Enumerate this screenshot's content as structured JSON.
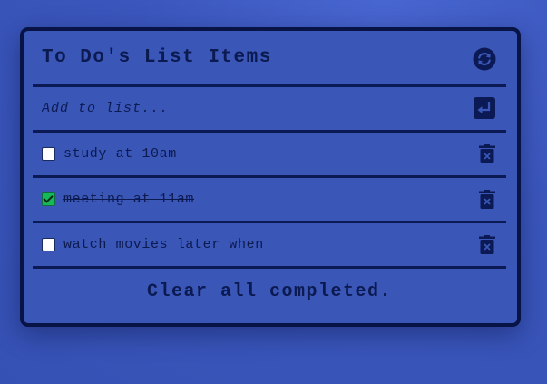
{
  "header": {
    "title": "To Do's List Items",
    "refresh_icon": "refresh-icon"
  },
  "add": {
    "placeholder": "Add to list...",
    "value": "",
    "enter_icon": "enter-icon"
  },
  "items": [
    {
      "label": "study at 10am",
      "completed": false,
      "delete_icon": "trash-icon"
    },
    {
      "label": "meeting at 11am",
      "completed": true,
      "delete_icon": "trash-icon"
    },
    {
      "label": "watch movies later when",
      "completed": false,
      "delete_icon": "trash-icon"
    }
  ],
  "footer": {
    "clear_label": "Clear all completed."
  },
  "colors": {
    "background": "#3b57bd",
    "border": "#081446",
    "checked": "#16b85a"
  }
}
